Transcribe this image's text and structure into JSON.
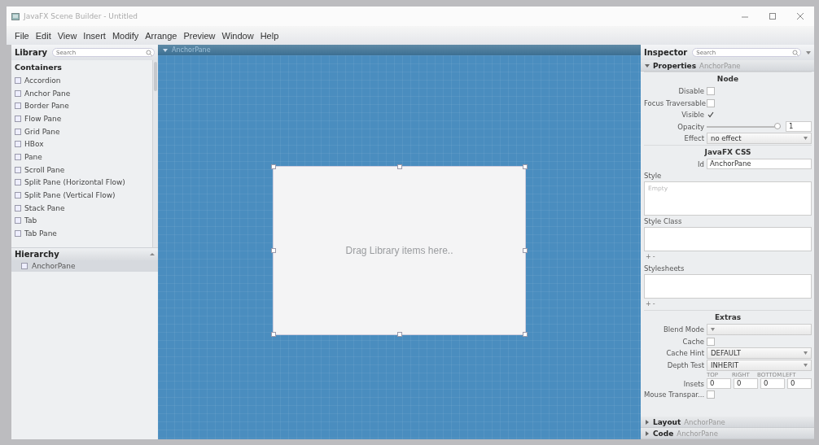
{
  "window": {
    "title": "JavaFX Scene Builder - Untitled"
  },
  "menu": [
    "File",
    "Edit",
    "View",
    "Insert",
    "Modify",
    "Arrange",
    "Preview",
    "Window",
    "Help"
  ],
  "library": {
    "title": "Library",
    "search_placeholder": "Search",
    "section": "Containers",
    "items": [
      {
        "label": "Accordion"
      },
      {
        "label": "Anchor Pane"
      },
      {
        "label": "Border Pane"
      },
      {
        "label": "Flow Pane"
      },
      {
        "label": "Grid Pane"
      },
      {
        "label": "HBox"
      },
      {
        "label": "Pane"
      },
      {
        "label": "Scroll Pane"
      },
      {
        "label": "Split Pane (Horizontal Flow)"
      },
      {
        "label": "Split Pane (Vertical Flow)"
      },
      {
        "label": "Stack Pane"
      },
      {
        "label": "Tab"
      },
      {
        "label": "Tab Pane"
      }
    ]
  },
  "hierarchy": {
    "title": "Hierarchy",
    "items": [
      {
        "label": "AnchorPane",
        "selected": true
      }
    ]
  },
  "canvas": {
    "tab_label": "AnchorPane",
    "placeholder": "Drag Library items here.."
  },
  "inspector": {
    "title": "Inspector",
    "search_placeholder": "Search",
    "properties": {
      "label": "Properties",
      "target": "AnchorPane",
      "expanded": true
    },
    "sections": [
      {
        "title": "Node",
        "rows": [
          {
            "kind": "checkbox",
            "label": "Disable",
            "checked": false
          },
          {
            "kind": "checkbox",
            "label": "Focus Traversable",
            "checked": false
          },
          {
            "kind": "checkbox",
            "label": "Visible",
            "checked": true
          },
          {
            "kind": "slider",
            "label": "Opacity",
            "level": 1,
            "value": "1"
          },
          {
            "kind": "select",
            "label": "Effect",
            "value": "no effect"
          }
        ]
      },
      {
        "title": "JavaFX CSS",
        "rows": [
          {
            "kind": "text",
            "label": "Id",
            "value": "AnchorPane"
          },
          {
            "kind": "textarea",
            "label": "Style",
            "placeholder": "Empty"
          },
          {
            "kind": "list",
            "label": "Style Class",
            "buttons": [
              "+",
              "-"
            ]
          },
          {
            "kind": "list",
            "label": "Stylesheets",
            "buttons": [
              "+",
              "-"
            ]
          }
        ]
      },
      {
        "title": "Extras",
        "rows": [
          {
            "kind": "select",
            "label": "Blend Mode"
          },
          {
            "kind": "checkbox",
            "label": "Cache",
            "checked": false
          },
          {
            "kind": "select",
            "label": "Cache Hint",
            "value": "DEFAULT"
          },
          {
            "kind": "select",
            "label": "Depth Test",
            "value": "INHERIT"
          },
          {
            "kind": "insets",
            "label": "Insets",
            "sides": [
              {
                "caption": "TOP",
                "value": "0"
              },
              {
                "caption": "RIGHT",
                "value": "0"
              },
              {
                "caption": "BOTTOM",
                "value": "0"
              },
              {
                "caption": "LEFT",
                "value": "0"
              }
            ]
          },
          {
            "kind": "checkbox",
            "label": "Mouse Transpar...",
            "checked": false
          }
        ]
      }
    ],
    "panels": [
      {
        "label": "Layout",
        "target": "AnchorPane",
        "expanded": false
      },
      {
        "label": "Code",
        "target": "AnchorPane",
        "expanded": false
      }
    ]
  }
}
